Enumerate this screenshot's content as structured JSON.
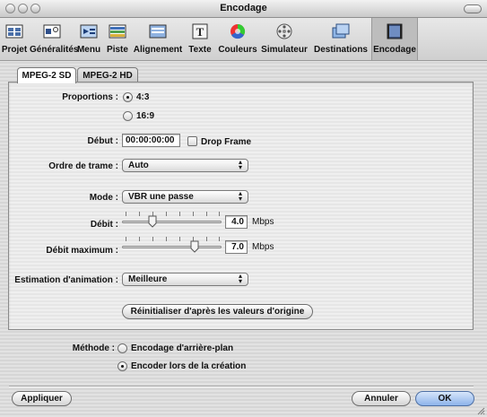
{
  "window": {
    "title": "Encodage"
  },
  "toolbar": {
    "items": [
      {
        "label": "Projet",
        "icon": "project-icon"
      },
      {
        "label": "Généralités",
        "icon": "general-icon"
      },
      {
        "label": "Menu",
        "icon": "menu-icon"
      },
      {
        "label": "Piste",
        "icon": "track-icon"
      },
      {
        "label": "Alignement",
        "icon": "alignment-icon"
      },
      {
        "label": "Texte",
        "icon": "text-icon"
      },
      {
        "label": "Couleurs",
        "icon": "colors-icon"
      },
      {
        "label": "Simulateur",
        "icon": "simulator-icon"
      },
      {
        "label": "Destinations",
        "icon": "destinations-icon"
      },
      {
        "label": "Encodage",
        "icon": "encoding-icon",
        "selected": true
      }
    ]
  },
  "tabs": [
    {
      "label": "MPEG-2 SD",
      "active": true
    },
    {
      "label": "MPEG-2 HD",
      "active": false
    }
  ],
  "form": {
    "proportions_label": "Proportions :",
    "proportions_options": [
      {
        "label": "4:3",
        "selected": true
      },
      {
        "label": "16:9",
        "selected": false
      }
    ],
    "debut_label": "Début :",
    "debut_value": "00:00:00:00",
    "drop_frame_label": "Drop Frame",
    "drop_frame_checked": false,
    "ordre_label": "Ordre de trame :",
    "ordre_value": "Auto",
    "mode_label": "Mode :",
    "mode_value": "VBR une passe",
    "debit_label": "Débit :",
    "debit_value": "4.0",
    "debit_unit": "Mbps",
    "debit_max_label": "Débit maximum :",
    "debit_max_value": "7.0",
    "debit_max_unit": "Mbps",
    "estimation_label": "Estimation d'animation :",
    "estimation_value": "Meilleure",
    "reset_button": "Réinitialiser d'après les valeurs d'origine"
  },
  "method": {
    "label": "Méthode :",
    "options": [
      {
        "label": "Encodage d'arrière-plan",
        "selected": false
      },
      {
        "label": "Encoder lors de la création",
        "selected": true
      }
    ]
  },
  "footer": {
    "apply": "Appliquer",
    "cancel": "Annuler",
    "ok": "OK"
  }
}
